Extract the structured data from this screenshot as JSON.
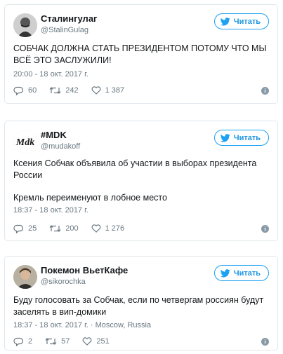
{
  "follow_label": "Читать",
  "tweets": [
    {
      "name": "Сталингулаг",
      "handle": "@StalinGulag",
      "text": "СОБЧАК ДОЛЖНА СТАТЬ ПРЕЗИДЕНТОМ ПОТОМУ ЧТО МЫ ВСЁ ЭТО ЗАСЛУЖИЛИ!",
      "meta": "20:00 - 18 окт. 2017 г.",
      "replies": "60",
      "retweets": "242",
      "likes": "1 387"
    },
    {
      "name": "#MDK",
      "handle": "@mudakoff",
      "text_paragraph_1": "Ксения Собчак объявила об участии в выборах президента России",
      "text_paragraph_2": "Кремль переименуют в лобное место",
      "meta": "18:37 - 18 окт. 2017 г.",
      "replies": "25",
      "retweets": "200",
      "likes": "1 276"
    },
    {
      "name": "Покемон ВьетКафе",
      "handle": "@sikorochka",
      "text": "Буду голосовать за Собчак, если по четвергам россиян будут заселять в вип-домики",
      "meta": "18:37 - 18 окт. 2017 г. · Moscow, Russia",
      "replies": "2",
      "retweets": "57",
      "likes": "251"
    }
  ],
  "colors": {
    "accent": "#1da1f2",
    "secondary_text": "#697882",
    "border": "#e1e8ed"
  },
  "icons": [
    "twitter-bird-icon",
    "reply-icon",
    "retweet-icon",
    "like-heart-icon",
    "info-icon"
  ]
}
